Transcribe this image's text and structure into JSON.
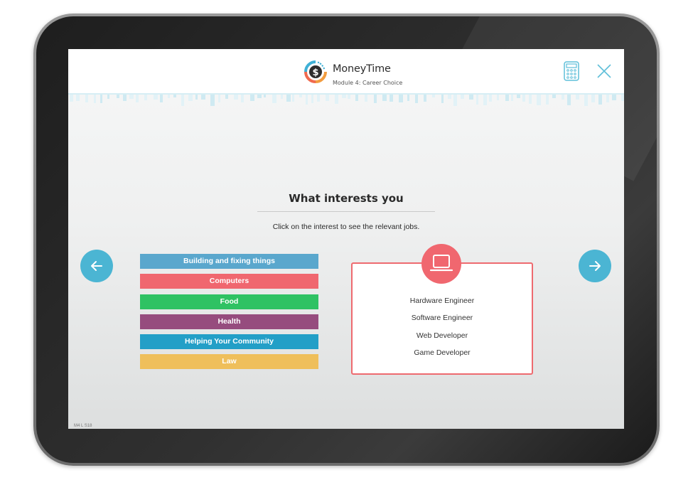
{
  "header": {
    "app_title": "MoneyTime",
    "module_subtitle": "Module 4: Career Choice",
    "logo_icon": "dollar-coin-icon",
    "calculator_icon": "calculator-icon",
    "close_icon": "close-icon"
  },
  "main": {
    "question": "What interests you",
    "instruction": "Click on the interest to see the relevant jobs.",
    "interests": [
      {
        "label": "Building and fixing things",
        "color": "#5aa7cd"
      },
      {
        "label": "Computers",
        "color": "#f0676f"
      },
      {
        "label": "Food",
        "color": "#2fc263"
      },
      {
        "label": "Health",
        "color": "#964c7e"
      },
      {
        "label": "Helping Your Community",
        "color": "#239fc7"
      },
      {
        "label": "Law",
        "color": "#efbf5b"
      }
    ],
    "selected_interest": "Computers",
    "jobs_icon": "laptop-icon",
    "jobs": [
      "Hardware Engineer",
      "Software Engineer",
      "Web Developer",
      "Game Developer"
    ]
  },
  "nav": {
    "prev_icon": "arrow-left-icon",
    "next_icon": "arrow-right-icon"
  },
  "colors": {
    "accent": "#4bb5d3",
    "selected": "#f0676f"
  },
  "footer": {
    "slide_id": "M4 L S18"
  }
}
